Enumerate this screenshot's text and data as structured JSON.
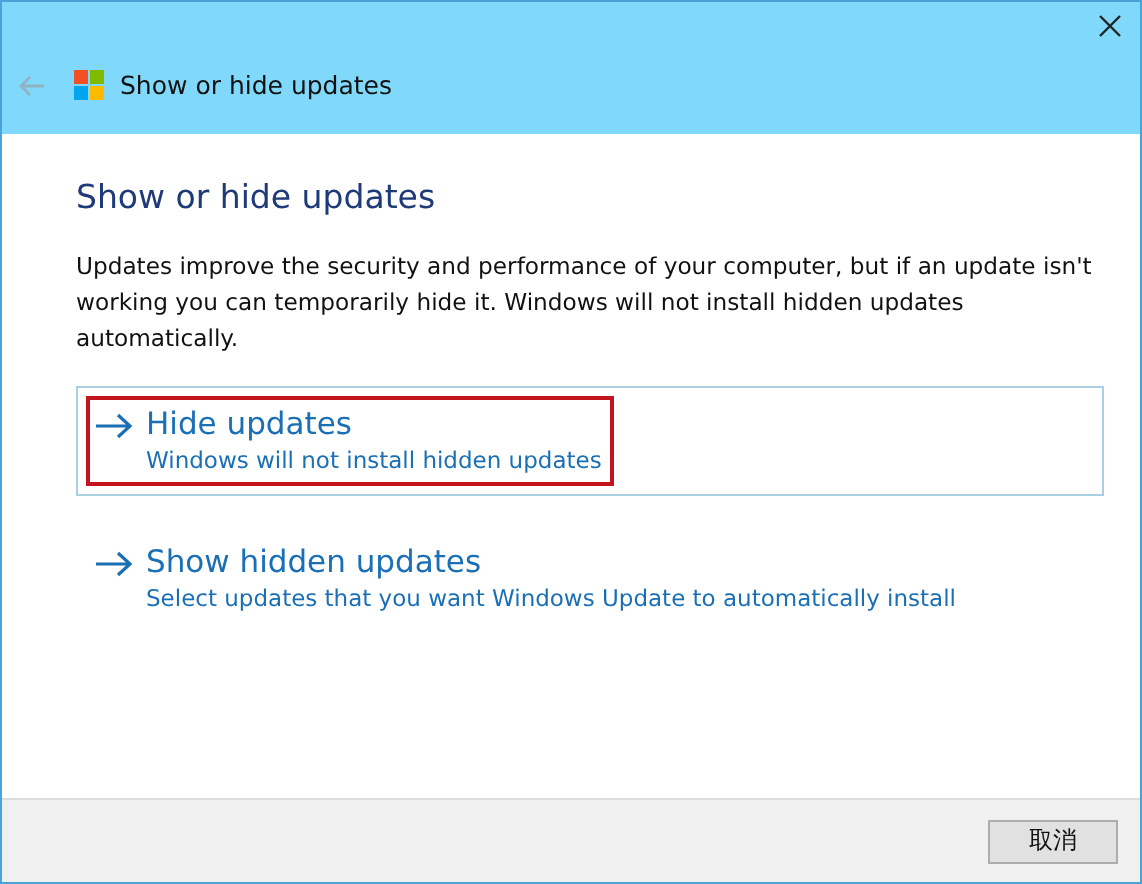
{
  "window": {
    "title": "Show or hide updates"
  },
  "heading": "Show or hide updates",
  "description": "Updates improve the security and performance of your computer, but if an update isn't working you can temporarily hide it. Windows will not install hidden updates automatically.",
  "options": [
    {
      "title": "Hide updates",
      "subtitle": "Windows will not install hidden updates",
      "selected": true,
      "annotated": true
    },
    {
      "title": "Show hidden updates",
      "subtitle": "Select updates that you want Windows Update to automatically install",
      "selected": false,
      "annotated": false
    }
  ],
  "buttons": [
    "取消"
  ]
}
